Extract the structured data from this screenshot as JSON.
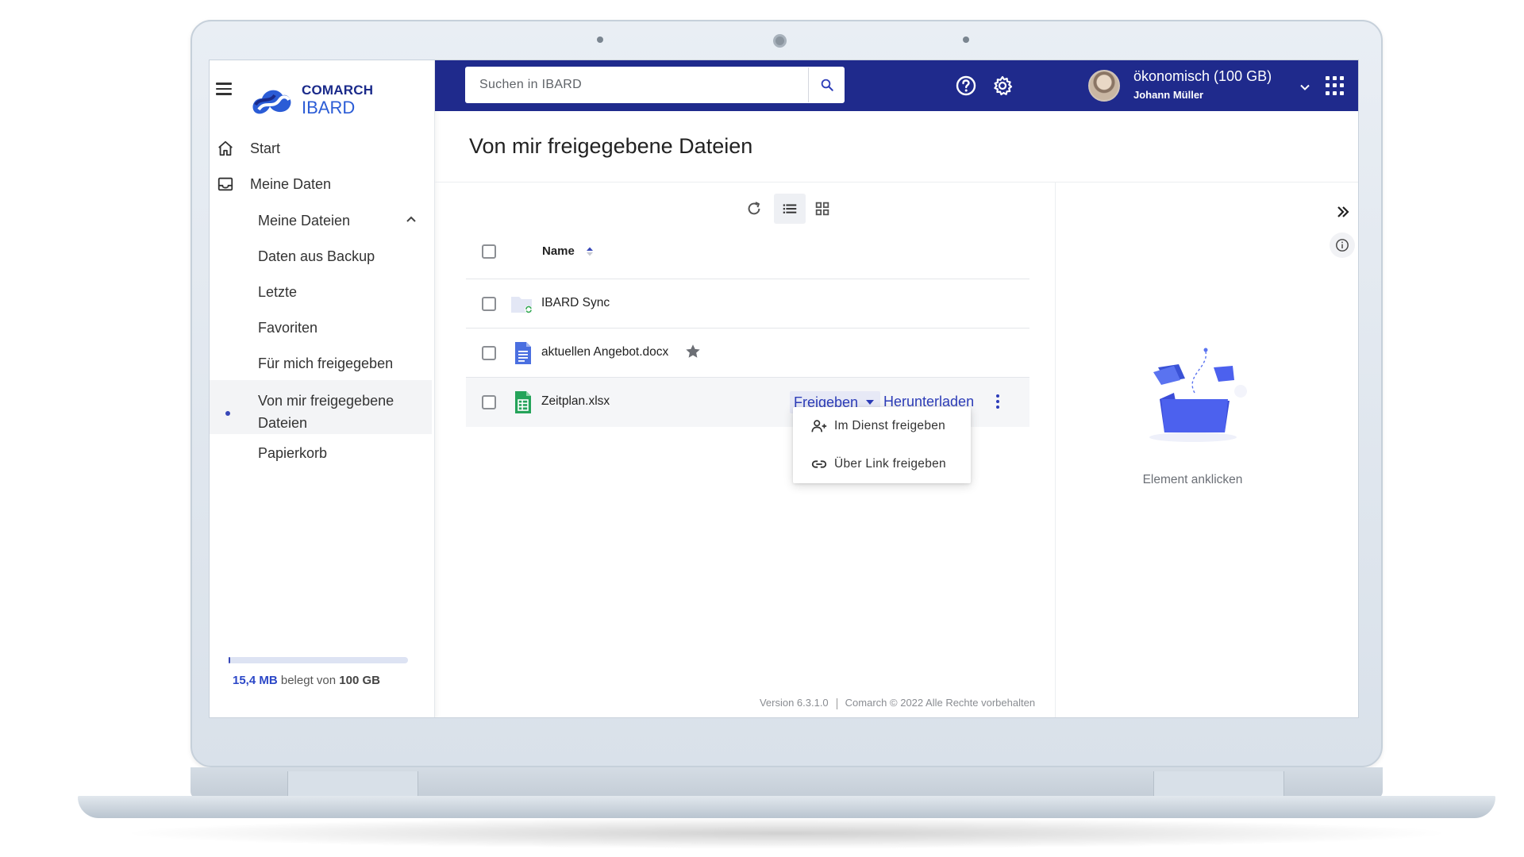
{
  "app": {
    "logo_line1": "COMARCH",
    "logo_line2": "IBARD",
    "brand_color": "#1f2a8c",
    "accent_color": "#2c3cb8"
  },
  "sidebar": {
    "items": [
      {
        "label": "Start",
        "icon": "home-icon"
      },
      {
        "label": "Meine Daten",
        "icon": "inbox-icon",
        "expanded": true
      }
    ],
    "sub_items": [
      {
        "label": "Meine Dateien"
      },
      {
        "label": "Daten aus Backup"
      },
      {
        "label": "Letzte"
      },
      {
        "label": "Favoriten"
      },
      {
        "label": "Für mich freigegeben"
      },
      {
        "label": "Von mir freigegebene Dateien",
        "active": true
      },
      {
        "label": "Papierkorb"
      }
    ],
    "storage": {
      "used": "15,4 MB",
      "middle": "belegt von",
      "total": "100 GB",
      "fraction_used": 0.00015
    }
  },
  "topbar": {
    "search_placeholder": "Suchen in IBARD",
    "plan": "ökonomisch (100 GB)",
    "user": "Johann Müller"
  },
  "main": {
    "title": "Von mir freigegebene Dateien",
    "table_header": "Name",
    "files": [
      {
        "name": "IBARD Sync",
        "type": "folder"
      },
      {
        "name": "aktuellen Angebot.docx",
        "type": "docx",
        "favorite": true
      },
      {
        "name": "Zeitplan.xlsx",
        "type": "xlsx",
        "hovered": true
      }
    ],
    "actions": {
      "share": "Freigeben",
      "download": "Herunterladen"
    },
    "share_menu": [
      {
        "label": "Im Dienst freigeben",
        "icon": "add-user-icon"
      },
      {
        "label": "Über Link freigeben",
        "icon": "link-icon"
      }
    ]
  },
  "details": {
    "empty_text": "Element anklicken"
  },
  "footer": {
    "version": "Version 6.3.1.0",
    "copyright": "Comarch © 2022 Alle Rechte vorbehalten"
  }
}
